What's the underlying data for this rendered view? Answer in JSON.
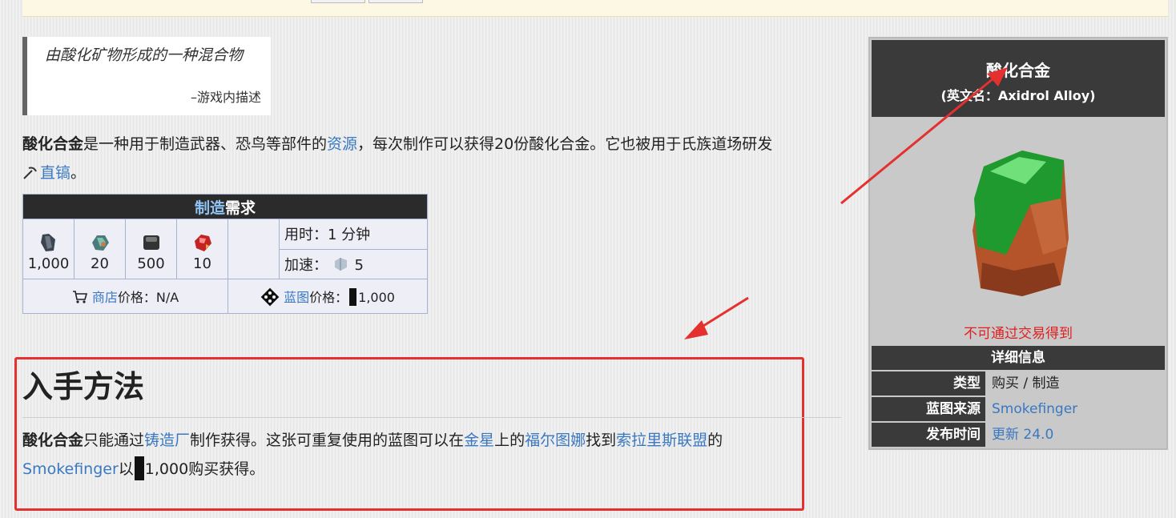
{
  "quote": {
    "text": "由酸化矿物形成的一种混合物",
    "source": "–游戏内描述"
  },
  "intro": {
    "bold": "酸化合金",
    "text1": "是一种用于制造武器、恐鸟等部件的",
    "link_resource": "资源",
    "text2": "，每次制作可以获得20份酸化合金。它也被用于氏族道场研发",
    "link_pick": "直镐",
    "end": "。"
  },
  "craft": {
    "header_link": "制造",
    "header_text": "需求",
    "materials": [
      {
        "icon": "ferrite-icon",
        "qty": "1,000"
      },
      {
        "icon": "crystal-icon",
        "qty": "20"
      },
      {
        "icon": "alloy-plate-icon",
        "qty": "500"
      },
      {
        "icon": "gem-icon",
        "qty": "10"
      }
    ],
    "time_label": "用时：1 分钟",
    "rush_label": "加速：",
    "rush_value": "5",
    "market_link": "商店",
    "market_text": "价格：N/A",
    "blueprint_link": "蓝图",
    "blueprint_text": "价格：",
    "blueprint_value": "1,000"
  },
  "acquisition": {
    "heading": "入手方法",
    "bold": "酸化合金",
    "t1": "只能通过",
    "link_foundry": "铸造厂",
    "t2": "制作获得。这张可重复使用的蓝图可以在",
    "link_venus": "金星",
    "t3": "上的",
    "link_fortuna": "福尔图娜",
    "t4": "找到",
    "link_solaris": "索拉里斯联盟",
    "t5": "的",
    "link_vendor": "Smokefinger",
    "t6": "以",
    "t7": "1,000购买获得。"
  },
  "infobox": {
    "title": "酸化合金",
    "subtitle": "(英文名：Axidrol Alloy)",
    "image_icon": "axidrol-alloy-icon",
    "note": "不可通过交易得到",
    "section": "详细信息",
    "rows": [
      {
        "key": "类型",
        "value": "购买 / 制造"
      },
      {
        "key": "蓝图来源",
        "value": "Smokefinger"
      },
      {
        "key": "发布时间",
        "value": "更新 24.0"
      }
    ]
  },
  "colors": {
    "link": "#3a78c2",
    "annotation_red": "#e53030",
    "header_dark": "#2b2b2b"
  }
}
